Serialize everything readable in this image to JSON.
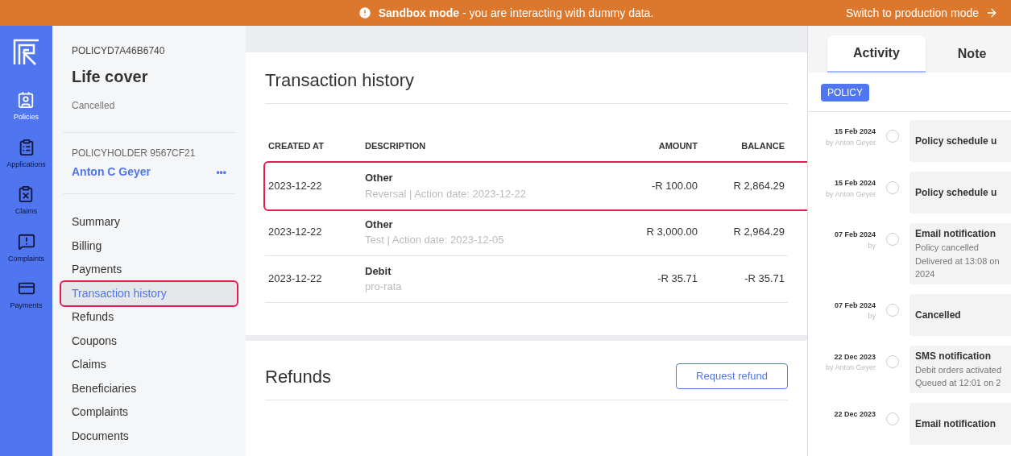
{
  "banner": {
    "bold": "Sandbox mode",
    "text": " - you are interacting with dummy data.",
    "action": "Switch to production mode"
  },
  "rail": [
    {
      "label": "Policies",
      "selected": true
    },
    {
      "label": "Applications",
      "selected": false
    },
    {
      "label": "Claims",
      "selected": false
    },
    {
      "label": "Complaints",
      "selected": false
    },
    {
      "label": "Payments",
      "selected": false
    }
  ],
  "policy": {
    "id": "POLICYD7A46B6740",
    "title": "Life cover",
    "status": "Cancelled",
    "holder_label": "POLICYHOLDER 9567CF21",
    "holder_name": "Anton C Geyer",
    "more": "•••"
  },
  "nav": [
    {
      "label": "Summary",
      "selected": false,
      "highlighted": false
    },
    {
      "label": "Billing",
      "selected": false,
      "highlighted": false
    },
    {
      "label": "Payments",
      "selected": false,
      "highlighted": false
    },
    {
      "label": "Transaction history",
      "selected": true,
      "highlighted": true
    },
    {
      "label": "Refunds",
      "selected": false,
      "highlighted": false
    },
    {
      "label": "Coupons",
      "selected": false,
      "highlighted": false
    },
    {
      "label": "Claims",
      "selected": false,
      "highlighted": false
    },
    {
      "label": "Beneficiaries",
      "selected": false,
      "highlighted": false
    },
    {
      "label": "Complaints",
      "selected": false,
      "highlighted": false
    },
    {
      "label": "Documents",
      "selected": false,
      "highlighted": false
    }
  ],
  "transactions": {
    "title": "Transaction history",
    "columns": [
      "CREATED AT",
      "DESCRIPTION",
      "AMOUNT",
      "BALANCE"
    ],
    "rows": [
      {
        "created_at": "2023-12-22",
        "type": "Other",
        "detail": "Reversal | Action date: 2023-12-22",
        "amount": "-R 100.00",
        "balance": "R 2,864.29",
        "highlighted": true
      },
      {
        "created_at": "2023-12-22",
        "type": "Other",
        "detail": "Test | Action date: 2023-12-05",
        "amount": "R 3,000.00",
        "balance": "R 2,964.29",
        "highlighted": false
      },
      {
        "created_at": "2023-12-22",
        "type": "Debit",
        "detail": "pro-rata",
        "amount": "-R 35.71",
        "balance": "-R 35.71",
        "highlighted": false
      }
    ]
  },
  "refunds": {
    "title": "Refunds",
    "button": "Request refund"
  },
  "activity": {
    "tabs": [
      {
        "label": "Activity",
        "selected": true
      },
      {
        "label": "Note",
        "selected": false
      }
    ],
    "filter": "POLICY",
    "items": [
      {
        "date": "15 Feb 2024",
        "by": "by Anton Geyer",
        "title": "Policy schedule u"
      },
      {
        "date": "15 Feb 2024",
        "by": "by Anton Geyer",
        "title": "Policy schedule u"
      },
      {
        "date": "07 Feb 2024",
        "by": "by",
        "title": "Email notification",
        "lines": [
          "Policy cancelled",
          "Delivered at 13:08 on",
          "2024"
        ]
      },
      {
        "date": "07 Feb 2024",
        "by": "by",
        "title": "Cancelled"
      },
      {
        "date": "22 Dec 2023",
        "by": "by Anton Geyer",
        "title": "SMS notification",
        "lines": [
          "Debit orders activated",
          "Queued at 12:01 on 2"
        ]
      },
      {
        "date": "22 Dec 2023",
        "title": "Email notification"
      }
    ]
  }
}
